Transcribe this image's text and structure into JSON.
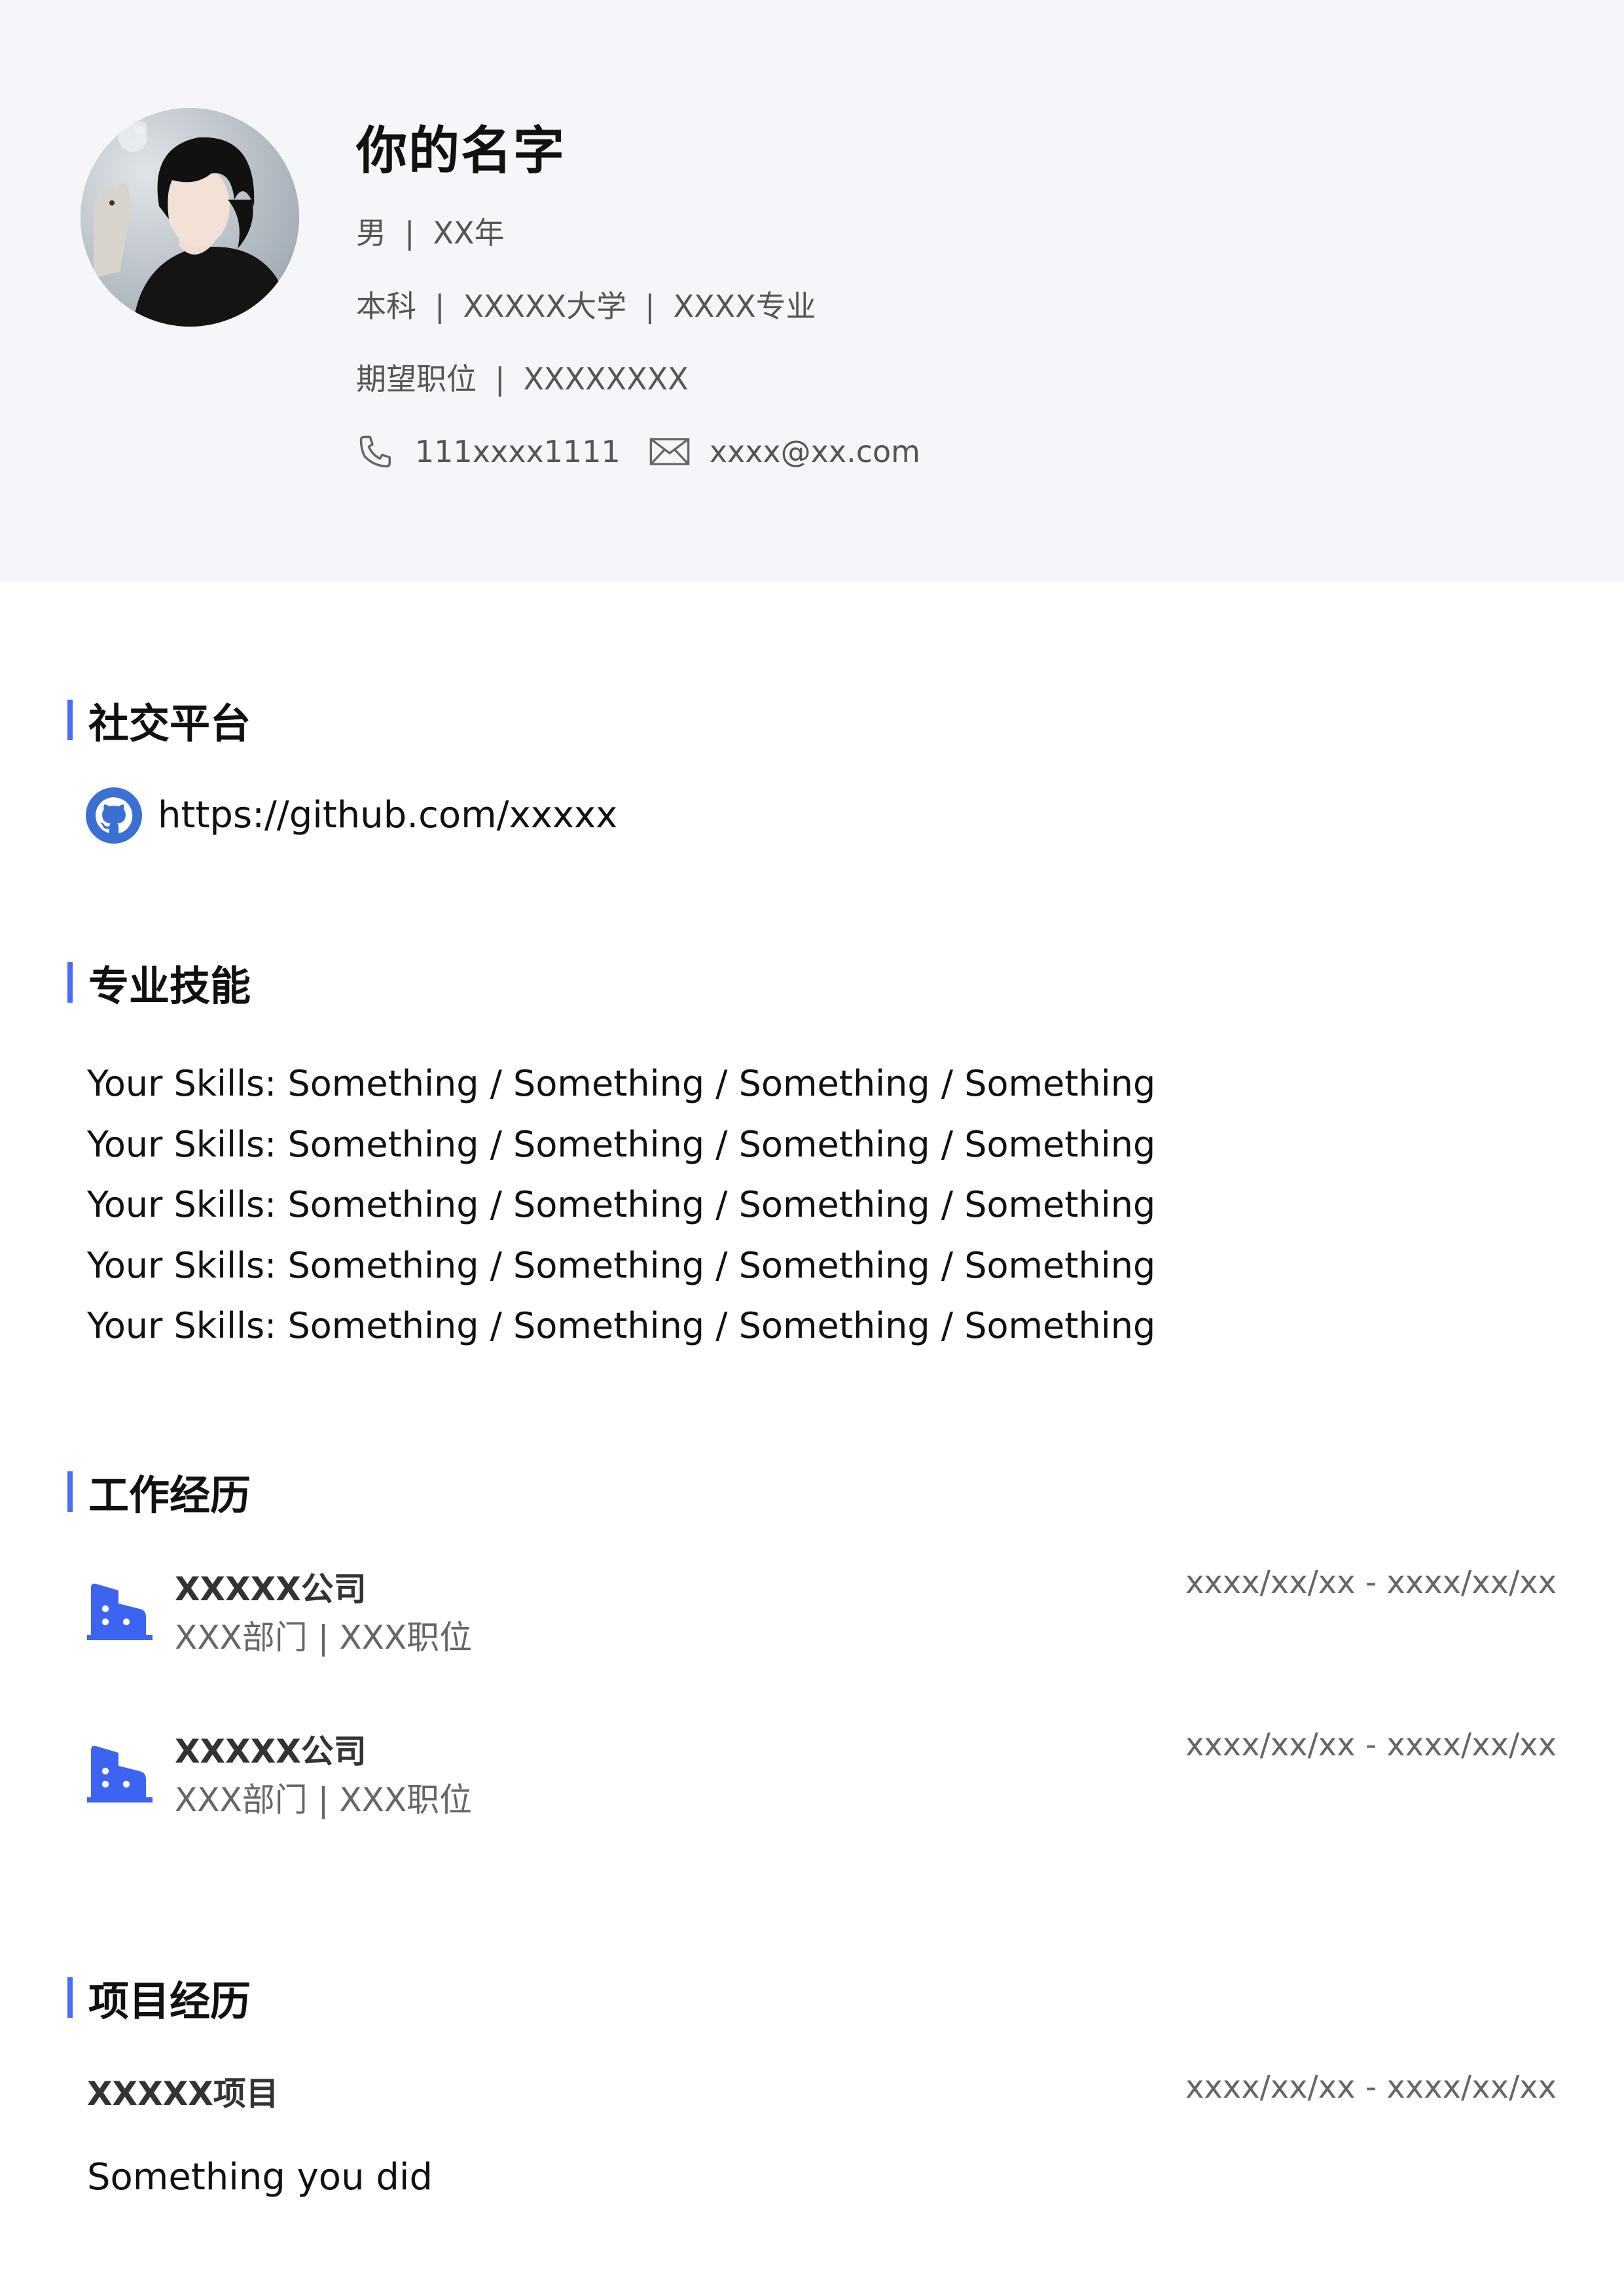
{
  "header": {
    "name": "你的名字",
    "gender": "男",
    "age": "XX年",
    "degree": "本科",
    "university": "XXXXX大学",
    "major": "XXXX专业",
    "position_label": "期望职位",
    "position_value": "XXXXXXXX",
    "phone": "111xxxx1111",
    "email": "xxxx@xx.com",
    "separator": "|"
  },
  "social": {
    "title": "社交平台",
    "github": "https://github.com/xxxxx"
  },
  "skills": {
    "title": "专业技能",
    "lines": [
      "Your Skills: Something / Something / Something / Something",
      "Your Skills: Something / Something / Something / Something",
      "Your Skills: Something / Something / Something / Something",
      "Your Skills: Something / Something / Something / Something",
      "Your Skills: Something / Something / Something / Something"
    ]
  },
  "work": {
    "title": "工作经历",
    "items": [
      {
        "company": "XXXXX公司",
        "role": "XXX部门 | XXX职位",
        "date": "xxxx/xx/xx - xxxx/xx/xx"
      },
      {
        "company": "XXXXX公司",
        "role": "XXX部门 | XXX职位",
        "date": "xxxx/xx/xx - xxxx/xx/xx"
      }
    ]
  },
  "projects": {
    "title": "项目经历",
    "items": [
      {
        "name": "XXXXX项目",
        "date": "xxxx/xx/xx - xxxx/xx/xx",
        "description": "Something you did"
      }
    ]
  },
  "colors": {
    "accent": "#4a6cf7",
    "header_bg": "#f5f6f9",
    "github_icon": "#3b6fd4"
  },
  "icons": [
    "phone-icon",
    "mail-icon",
    "github-icon",
    "building-icon"
  ]
}
